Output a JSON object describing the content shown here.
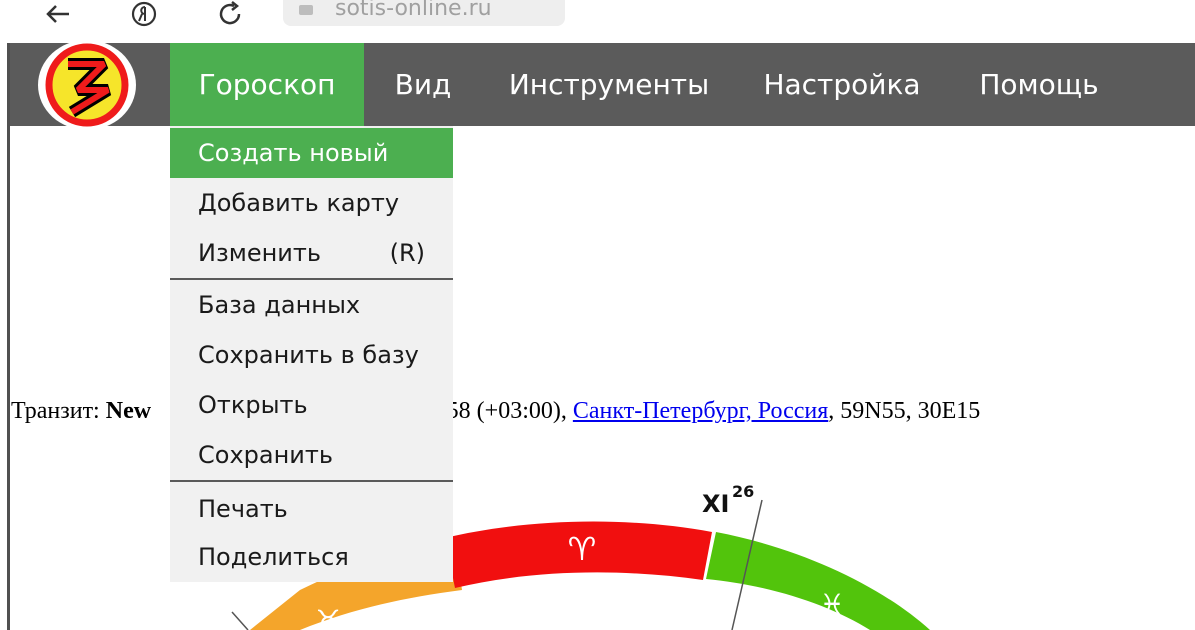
{
  "browser": {
    "url": "sotis-online.ru"
  },
  "menubar": {
    "items": [
      {
        "label": "Гороскоп",
        "active": true
      },
      {
        "label": "Вид"
      },
      {
        "label": "Инструменты"
      },
      {
        "label": "Настройка"
      },
      {
        "label": "Помощь"
      }
    ]
  },
  "dropdown": {
    "items": [
      {
        "label": "Создать новый",
        "selected": true
      },
      {
        "label": "Добавить карту"
      },
      {
        "label": "Изменить",
        "shortcut": "(R)"
      },
      {
        "label": "База данных"
      },
      {
        "label": "Сохранить в базу"
      },
      {
        "label": "Открыть"
      },
      {
        "label": "Сохранить"
      },
      {
        "label": "Печать"
      },
      {
        "label": "Поделиться"
      }
    ]
  },
  "transit": {
    "prefix": "Транзит: ",
    "name": "New",
    "time": ":58 (+03:00), ",
    "place": "Санкт-Петербург, Россия",
    "coords": ", 59N55, 30E15"
  },
  "chart": {
    "house_label": "XI",
    "house_degree": "26",
    "signs": [
      {
        "glyph": "♈",
        "color": "#f10f0f"
      },
      {
        "glyph": "♓",
        "color": "#52c40c"
      },
      {
        "glyph": "♉",
        "color": "#f4a52b"
      }
    ]
  },
  "colors": {
    "menubar": "#5b5b5b",
    "accent": "#4caf50",
    "dropdown_bg": "#f1f1f1"
  }
}
